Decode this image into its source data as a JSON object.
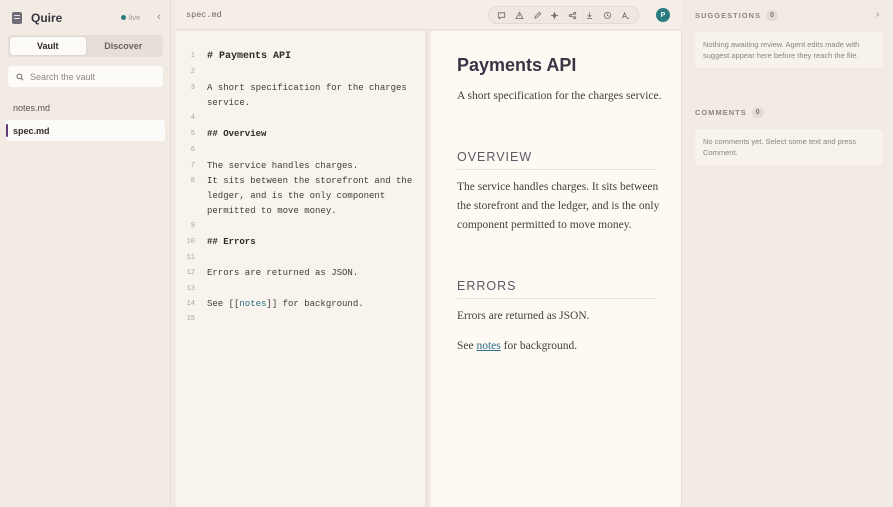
{
  "app": {
    "title": "Quire",
    "status": "live"
  },
  "sidebar": {
    "tabs": [
      {
        "label": "Vault"
      },
      {
        "label": "Discover"
      }
    ],
    "search_placeholder": "Search the vault",
    "files": [
      {
        "name": "notes.md"
      },
      {
        "name": "spec.md"
      }
    ]
  },
  "editor": {
    "filename": "spec.md",
    "lines": {
      "l1": "# Payments API",
      "l3a": "A short specification for the charges",
      "l3b": "service.",
      "l5": "## Overview",
      "l7": "The service handles charges.",
      "l8a": "It sits between the storefront and the",
      "l8b": "ledger, and is the only component",
      "l8c": "permitted to move money.",
      "l10": "## Errors",
      "l12": "Errors are returned as JSON.",
      "l14_pre": "See [[",
      "l14_link": "notes",
      "l14_post": "]] for background."
    }
  },
  "preview": {
    "h1": "Payments API",
    "intro": "A short specification for the charges service.",
    "h2_overview": "OVERVIEW",
    "overview_text": "The service handles charges. It sits between the storefront and the ledger, and is the only component permitted to move money.",
    "h2_errors": "ERRORS",
    "errors_text": "Errors are returned as JSON.",
    "see_pre": "See ",
    "see_link": "notes",
    "see_post": " for background."
  },
  "user": {
    "initial": "P",
    "avatar_color": "#2a7c80"
  },
  "right_panel": {
    "suggestions_title": "SUGGESTIONS",
    "suggestions_count": "0",
    "suggestions_empty": "Nothing awaiting review. Agent edits made with suggest appear here before they reach the file.",
    "comments_title": "COMMENTS",
    "comments_count": "0",
    "comments_empty": "No comments yet. Select some text and press Comment."
  },
  "colors": {
    "accent": "#2b6f86",
    "live": "#2b7a83",
    "active_marker": "#5e3a7a"
  }
}
